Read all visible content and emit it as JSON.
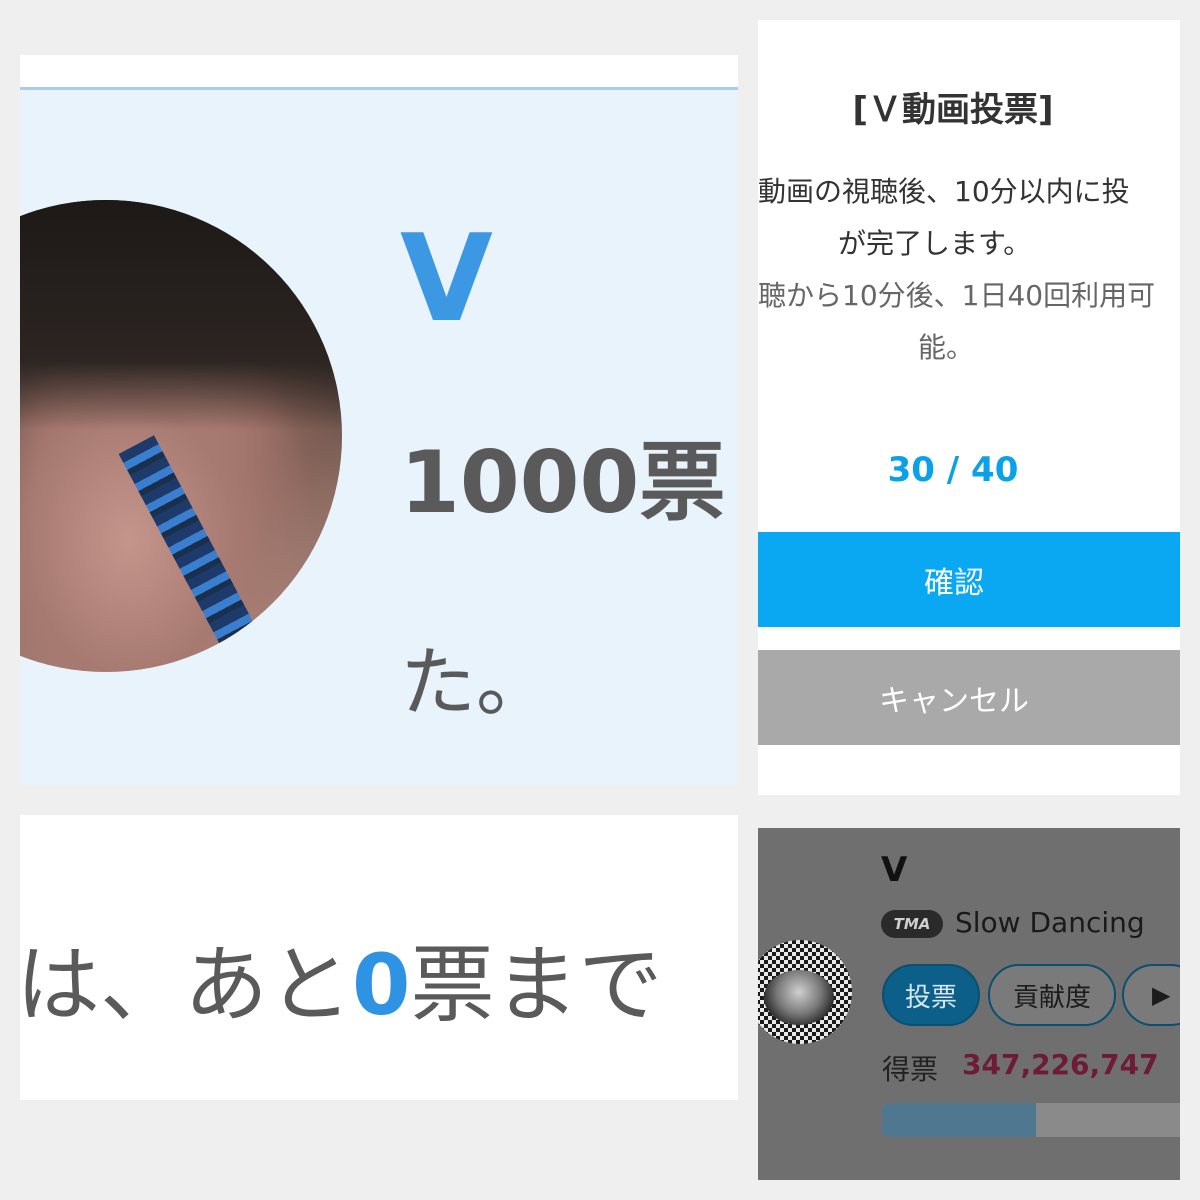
{
  "complete_card": {
    "artist": "V",
    "votes_text": "1000票",
    "done_text": "た。"
  },
  "remaining": {
    "prefix": "は、あと",
    "count": "0",
    "suffix": "票まで"
  },
  "vote_dialog": {
    "title": "[Ｖ動画投票]",
    "line1": "動画の視聴後、10分以内に投",
    "line2": "が完了します。",
    "line3": "聴から10分後、1日40回利用可",
    "line4": "能。",
    "count": "30 / 40",
    "confirm_label": "確認",
    "cancel_label": "キャンセル",
    "colors": {
      "confirm": "#0aa8f2",
      "cancel": "#a9a9a9",
      "count": "#0aa1e8"
    }
  },
  "artist_card": {
    "name": "V",
    "badge": "TMA",
    "song": "Slow Dancing",
    "vote_button": "投票",
    "contribution_button": "貢献度",
    "play_icon": "▶",
    "total_label": "得票",
    "total_votes": "347,226,747",
    "progress": 0.48
  }
}
